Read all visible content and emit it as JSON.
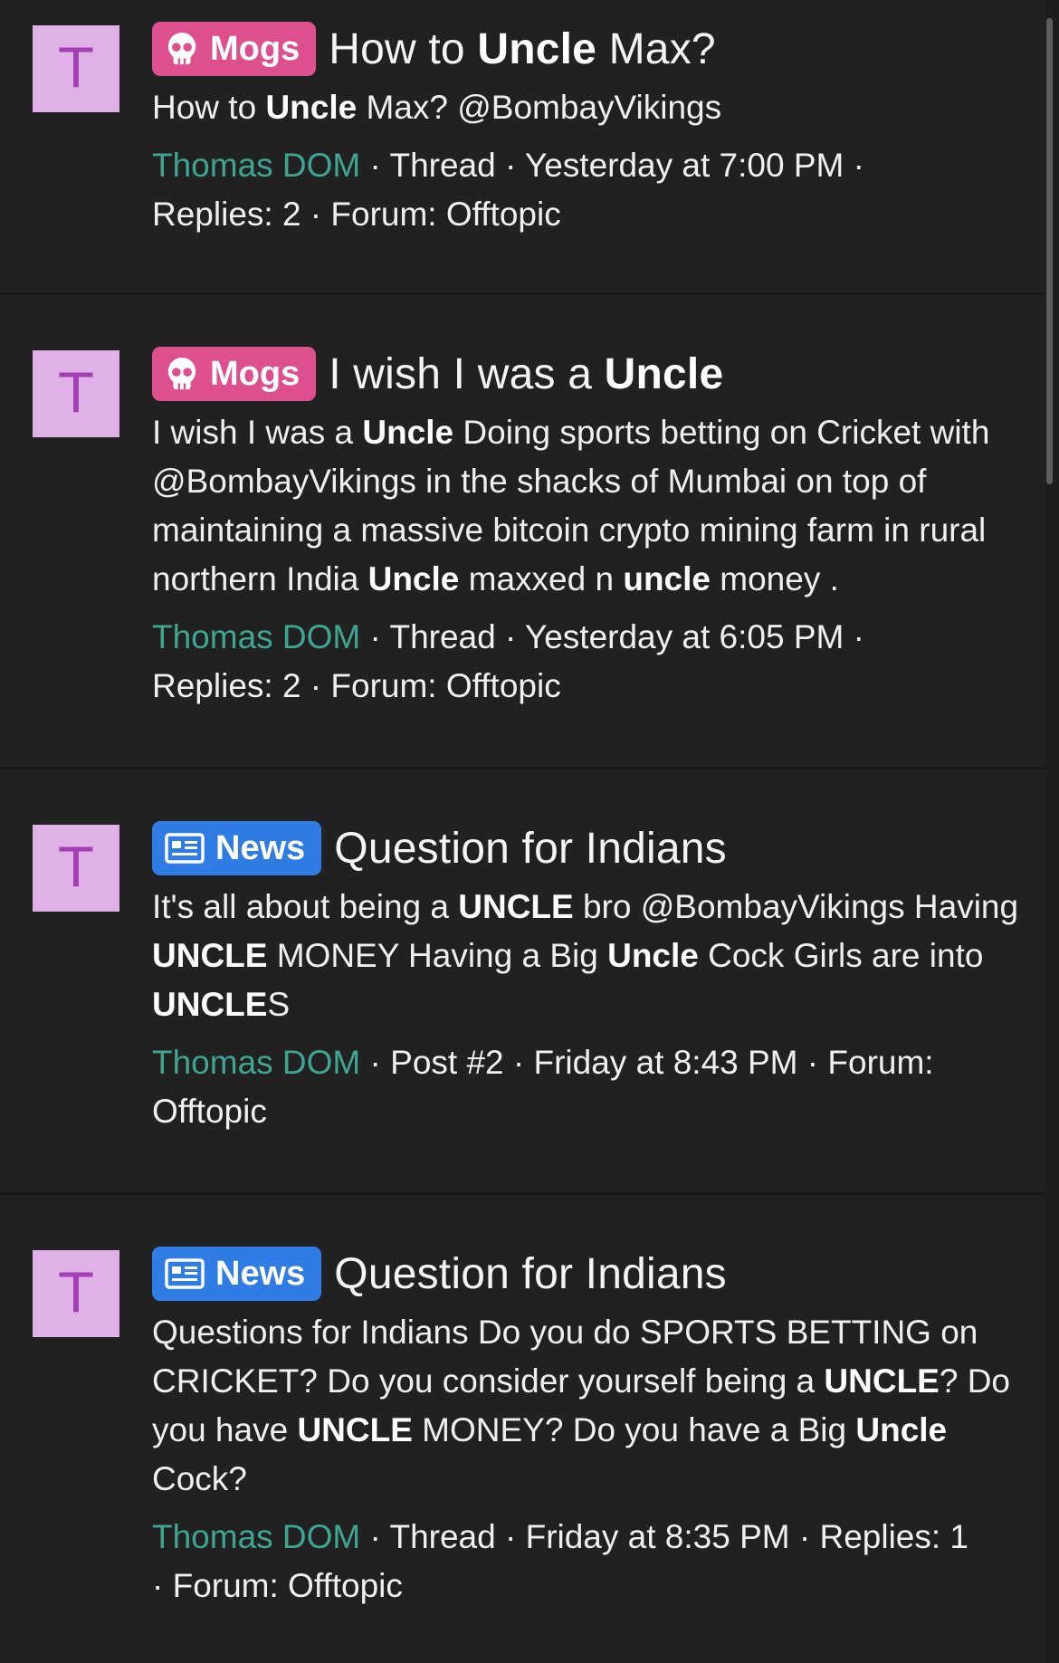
{
  "results": [
    {
      "avatar_letter": "T",
      "badge": {
        "label": "Mogs",
        "icon": "skull-icon",
        "color": "#dd4f8d"
      },
      "title": [
        {
          "t": "How to "
        },
        {
          "t": "Uncle",
          "b": true
        },
        {
          "t": " Max?"
        }
      ],
      "body": [
        {
          "t": "How to "
        },
        {
          "t": "Uncle",
          "b": true
        },
        {
          "t": " Max? @BombayVikings"
        }
      ],
      "author": "Thomas DOM",
      "meta_parts": [
        " · Thread · Yesterday at 7:00 PM · ",
        "Replies: 2 · Forum: Offtopic"
      ]
    },
    {
      "avatar_letter": "T",
      "badge": {
        "label": "Mogs",
        "icon": "skull-icon",
        "color": "#dd4f8d"
      },
      "title": [
        {
          "t": "I wish I was a "
        },
        {
          "t": "Uncle",
          "b": true
        }
      ],
      "body": [
        {
          "t": "I wish I was a "
        },
        {
          "t": "Uncle",
          "b": true
        },
        {
          "t": " Doing sports betting on Cricket with @BombayVikings in the shacks of Mumbai on top of maintaining a massive bitcoin crypto mining farm in rural northern India "
        },
        {
          "t": "Uncle",
          "b": true
        },
        {
          "t": " maxxed n "
        },
        {
          "t": "uncle",
          "b": true
        },
        {
          "t": " money ."
        }
      ],
      "author": "Thomas DOM",
      "meta_parts": [
        " · Thread · Yesterday at 6:05 PM · ",
        "Replies: 2 · Forum: Offtopic"
      ]
    },
    {
      "avatar_letter": "T",
      "badge": {
        "label": "News",
        "icon": "newspaper-icon",
        "color": "#2f7de4"
      },
      "title": [
        {
          "t": "Question for Indians"
        }
      ],
      "body": [
        {
          "t": "It's all about being a "
        },
        {
          "t": "UNCLE",
          "b": true
        },
        {
          "t": " bro @BombayVikings Having "
        },
        {
          "t": "UNCLE",
          "b": true
        },
        {
          "t": " MONEY Having a Big "
        },
        {
          "t": "Uncle",
          "b": true
        },
        {
          "t": " Cock Girls are into "
        },
        {
          "t": "UNCLE",
          "b": true
        },
        {
          "t": "S"
        }
      ],
      "author": "Thomas DOM",
      "meta_parts": [
        " · Post #2 · Friday at 8:43 PM · Forum: ",
        "Offtopic"
      ]
    },
    {
      "avatar_letter": "T",
      "badge": {
        "label": "News",
        "icon": "newspaper-icon",
        "color": "#2f7de4"
      },
      "title": [
        {
          "t": "Question for Indians"
        }
      ],
      "body": [
        {
          "t": "Questions for Indians Do you do SPORTS BETTING on CRICKET? Do you consider yourself being a "
        },
        {
          "t": "UNCLE",
          "b": true
        },
        {
          "t": "? Do you have "
        },
        {
          "t": "UNCLE",
          "b": true
        },
        {
          "t": " MONEY? Do you have a Big "
        },
        {
          "t": "Uncle",
          "b": true
        },
        {
          "t": " Cock?"
        }
      ],
      "author": "Thomas DOM",
      "meta_parts": [
        " · Thread · Friday at 8:35 PM · Replies: 1 ",
        "· Forum: Offtopic"
      ]
    }
  ]
}
